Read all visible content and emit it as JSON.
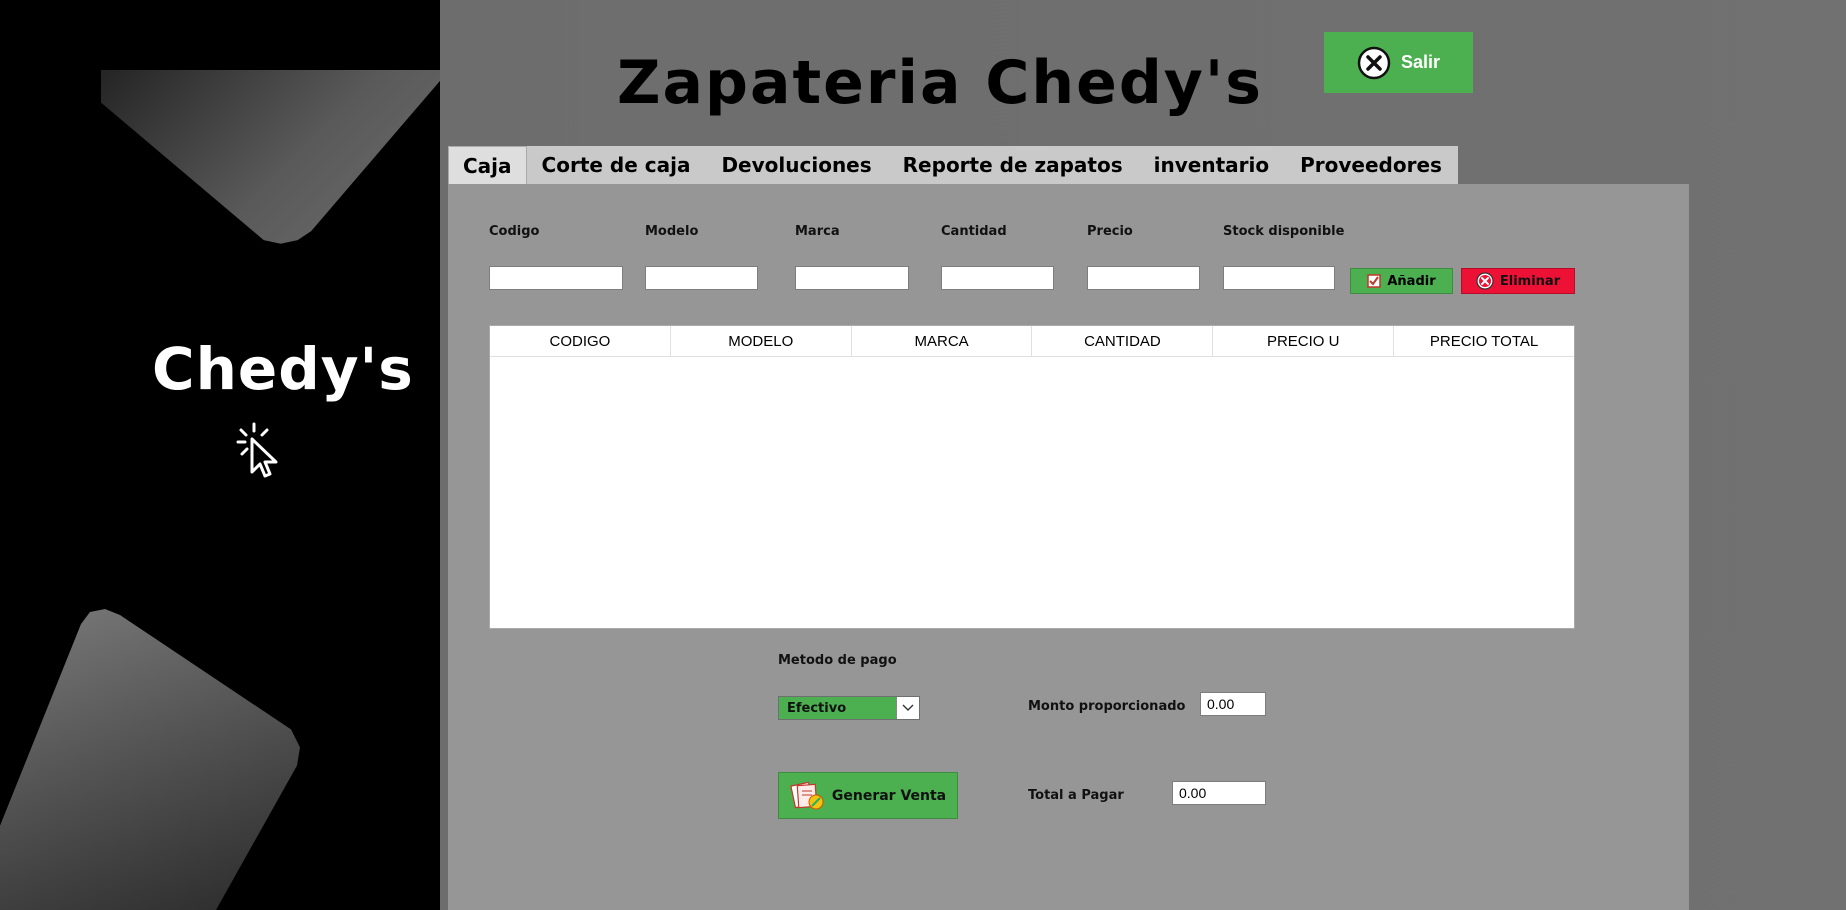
{
  "sidebar": {
    "brand": "Chedy's",
    "cursor_icon": "cursor-click-icon"
  },
  "header": {
    "title": "Zapateria Chedy's",
    "exit_label": "Salir",
    "exit_icon": "close-circle-icon"
  },
  "tabs": [
    {
      "label": "Caja",
      "active": true
    },
    {
      "label": "Corte de caja"
    },
    {
      "label": "Devoluciones"
    },
    {
      "label": "Reporte de zapatos"
    },
    {
      "label": "inventario"
    },
    {
      "label": "Proveedores"
    }
  ],
  "form": {
    "codigo_label": "Codigo",
    "codigo_value": "",
    "modelo_label": "Modelo",
    "modelo_value": "",
    "marca_label": "Marca",
    "marca_value": "",
    "cantidad_label": "Cantidad",
    "cantidad_value": "",
    "precio_label": "Precio",
    "precio_value": "",
    "stock_label": "Stock disponible",
    "stock_value": "",
    "add_label": "Añadir",
    "add_icon": "checkbox-icon",
    "delete_label": "Eliminar",
    "delete_icon": "close-circle-icon"
  },
  "table": {
    "columns": [
      "CODIGO",
      "MODELO",
      "MARCA",
      "CANTIDAD",
      "PRECIO U",
      "PRECIO TOTAL"
    ],
    "rows": []
  },
  "payment": {
    "method_label": "Metodo de pago",
    "method_value": "Efectivo",
    "amount_label": "Monto proporcionado",
    "amount_value": "0.00",
    "total_label": "Total a Pagar",
    "total_value": "0.00",
    "generate_label": "Generar Venta",
    "generate_icon": "receipt-icon"
  },
  "colors": {
    "accent_green": "#4caf50",
    "danger_red": "#ee1136",
    "panel_gray": "#969696"
  }
}
